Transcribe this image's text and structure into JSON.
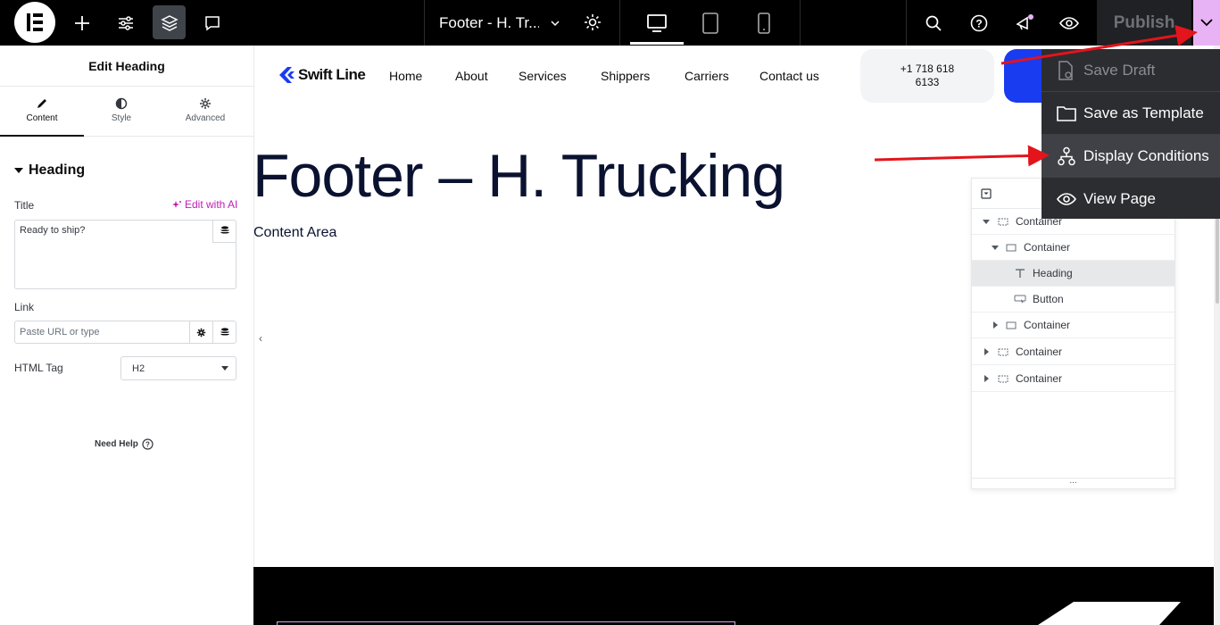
{
  "topbar": {
    "doc_title": "Footer - H. Tr...",
    "publish_label": "Publish"
  },
  "panel": {
    "header": "Edit Heading",
    "tabs": [
      {
        "label": "Content",
        "icon": "pencil-icon"
      },
      {
        "label": "Style",
        "icon": "half-circle-icon"
      },
      {
        "label": "Advanced",
        "icon": "gear-icon"
      }
    ],
    "section_title": "Heading",
    "title_label": "Title",
    "edit_ai": "Edit with AI",
    "title_value": "Ready to ship?",
    "link_label": "Link",
    "link_placeholder": "Paste URL or type",
    "html_tag_label": "HTML Tag",
    "html_tag_value": "H2",
    "need_help": "Need Help"
  },
  "site": {
    "brand": "Swift Line",
    "nav": [
      "Home",
      "About",
      "Services",
      "Shippers",
      "Carriers",
      "Contact us"
    ],
    "phone_line1": "+1 718 618",
    "phone_line2": "6133",
    "hero_title": "Footer – H. Trucking",
    "content_area": "Content Area"
  },
  "navigator": {
    "items": [
      {
        "label": "Container",
        "level": 0,
        "expanded": true
      },
      {
        "label": "Container",
        "level": 1,
        "expanded": true
      },
      {
        "label": "Heading",
        "level": 2,
        "selected": true
      },
      {
        "label": "Button",
        "level": 2
      },
      {
        "label": "Container",
        "level": 1,
        "expanded": false
      },
      {
        "label": "Container",
        "level": 0,
        "expanded": false
      },
      {
        "label": "Container",
        "level": 0,
        "expanded": false
      }
    ],
    "footer": "..."
  },
  "dropdown": {
    "items": [
      {
        "label": "Save Draft",
        "icon": "save-draft-icon",
        "disabled": true
      },
      {
        "label": "Save as Template",
        "icon": "folder-icon"
      },
      {
        "label": "Display Conditions",
        "icon": "sitemap-icon",
        "selected": true
      },
      {
        "label": "View Page",
        "icon": "eye-icon"
      }
    ]
  },
  "colors": {
    "accent_pink": "#e8b3f5",
    "annotation_red": "#e3141b",
    "brand_blue": "#1a3cf0"
  }
}
